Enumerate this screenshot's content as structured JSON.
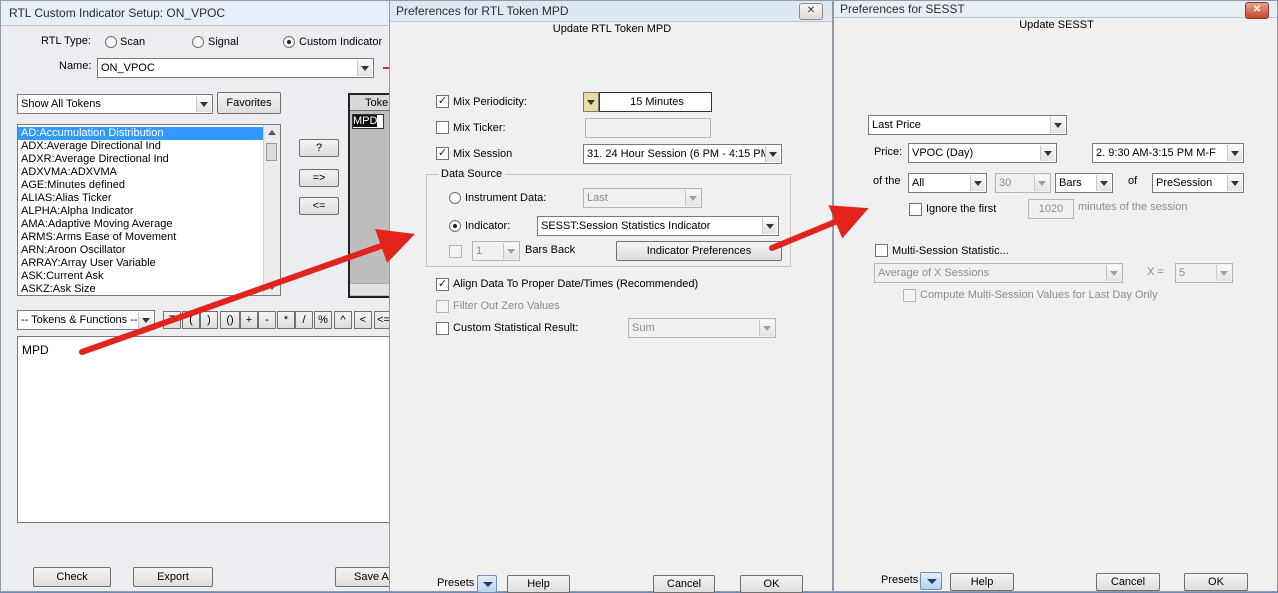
{
  "win1": {
    "title": "RTL Custom Indicator Setup: ON_VPOC",
    "rtl_type_label": "RTL Type:",
    "radio_scan": "Scan",
    "radio_signal": "Signal",
    "radio_custom": "Custom Indicator",
    "name_label": "Name:",
    "name_value": "ON_VPOC",
    "filter_value": "Show All Tokens",
    "favorites_label": "Favorites",
    "token_list": [
      "AD:Accumulation Distribution",
      "ADX:Average Directional Ind",
      "ADXR:Average Directional Ind",
      "ADXVMA:ADXVMA",
      "AGE:Minutes defined",
      "ALIAS:Alias Ticker",
      "ALPHA:Alpha Indicator",
      "AMA:Adaptive Moving Average",
      "ARMS:Arms Ease of Movement",
      "ARN:Aroon Oscillator",
      "ARRAY:Array User Variable",
      "ASK:Current Ask",
      "ASKZ:Ask Size"
    ],
    "btn_help": "?",
    "btn_add": "=>",
    "btn_remove": "<=",
    "token_col_header": "Toke",
    "token_cell": "MPD",
    "tokfunc_value": "-- Tokens & Functions --",
    "op_buttons": [
      "T",
      "(",
      ")",
      "()",
      "+",
      "-",
      "*",
      "/",
      "%",
      "^",
      "<",
      "<="
    ],
    "formula": "MPD",
    "btn_check": "Check",
    "btn_export": "Export",
    "btn_save": "Save A"
  },
  "win2": {
    "title": "Preferences for RTL Token MPD",
    "heading": "Update RTL Token MPD",
    "mix_periodicity_label": "Mix Periodicity:",
    "mix_periodicity_value": "15 Minutes",
    "mix_ticker_label": "Mix Ticker:",
    "mix_session_label": "Mix Session",
    "mix_session_value": "31. 24 Hour Session (6 PM - 4:15 PM",
    "data_source_legend": "Data Source",
    "instrument_label": "Instrument Data:",
    "instrument_value": "Last",
    "indicator_label": "Indicator:",
    "indicator_value": "SESST:Session Statistics Indicator",
    "bars_back_value": "1",
    "bars_back_label": "Bars Back",
    "indicator_prefs_btn": "Indicator Preferences",
    "align_label": "Align Data To Proper Date/Times (Recommended)",
    "filter_zero_label": "Filter Out Zero Values",
    "custom_stat_label": "Custom Statistical Result:",
    "custom_stat_value": "Sum",
    "presets_label": "Presets",
    "help_label": "Help",
    "cancel_label": "Cancel",
    "ok_label": "OK"
  },
  "win3": {
    "title": "Preferences for SESST",
    "heading": "Update SESST",
    "price_source_value": "Last Price",
    "price_label": "Price:",
    "price_value": "VPOC  (Day)",
    "session_value": "2. 9:30 AM-3:15 PM M-F",
    "of_the_label": "of the",
    "range_value": "All",
    "count_value": "30",
    "unit_value": "Bars",
    "of_label": "of",
    "presession_value": "PreSession",
    "ignore_label": "Ignore the first",
    "ignore_value": "1020",
    "minutes_label": "minutes of the session",
    "multi_label": "Multi-Session Statistic...",
    "avg_value": "Average of X Sessions",
    "x_label": "X =",
    "x_value": "5",
    "compute_label": "Compute Multi-Session Values for Last Day Only",
    "presets_label": "Presets",
    "help_label": "Help",
    "cancel_label": "Cancel",
    "ok_label": "OK"
  }
}
